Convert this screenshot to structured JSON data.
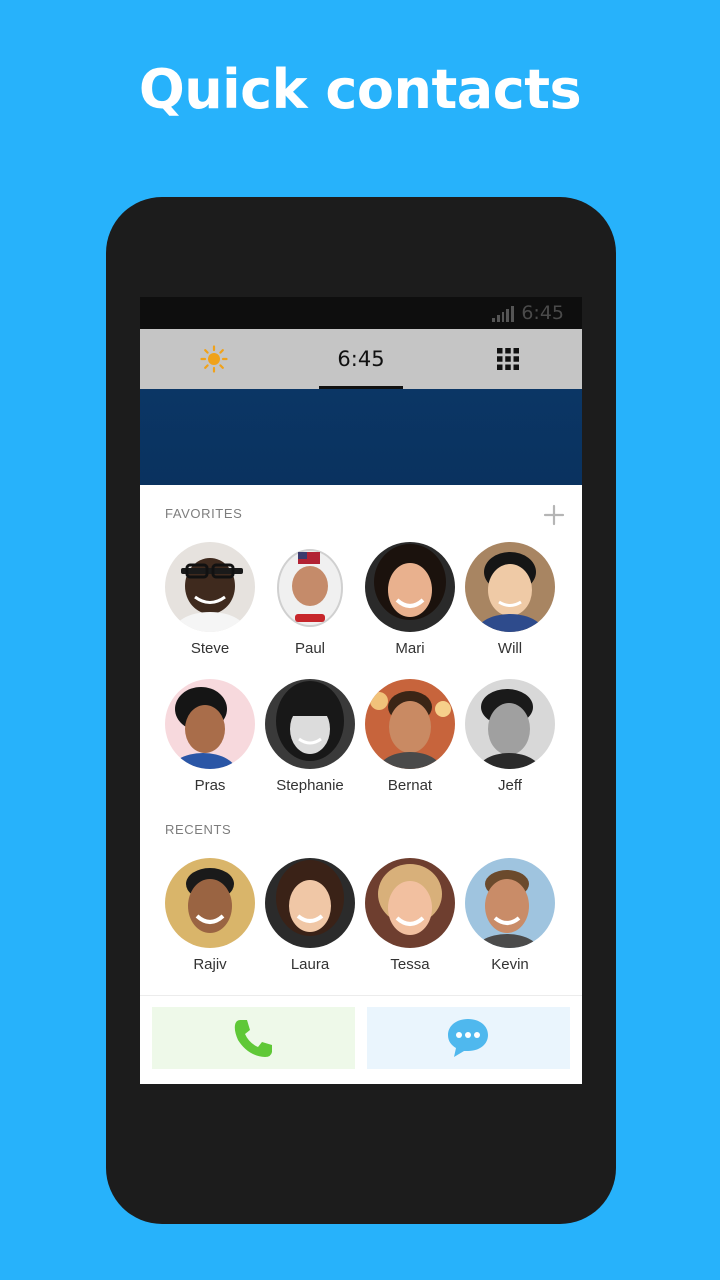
{
  "headline": "Quick contacts",
  "status": {
    "time": "6:45"
  },
  "tabs": {
    "active_clock": "6:45"
  },
  "favorites": {
    "label": "FAVORITES",
    "contacts": [
      "Steve",
      "Paul",
      "Mari",
      "Will",
      "Pras",
      "Stephanie",
      "Bernat",
      "Jeff"
    ]
  },
  "recents": {
    "label": "RECENTS",
    "contacts": [
      "Rajiv",
      "Laura",
      "Tessa",
      "Kevin"
    ]
  },
  "colors": {
    "background": "#27b2fb",
    "phone_body": "#1c1c1c",
    "banner": "#0b3665",
    "call_button_bg": "#eef9e9",
    "call_icon": "#5fc837",
    "message_button_bg": "#eaf5fd",
    "message_icon": "#4fb8ee",
    "sun_icon": "#f0a21a"
  }
}
